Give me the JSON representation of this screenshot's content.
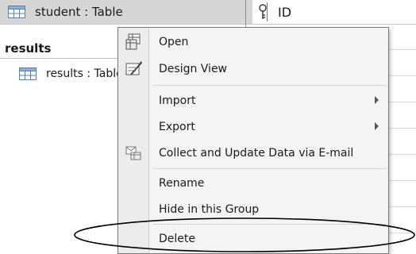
{
  "nav": {
    "selected_item": "student : Table",
    "group_header": "results",
    "child_item": "results : Table"
  },
  "table_header": {
    "column_label": "ID",
    "key_icon": "primary-key-icon"
  },
  "context_menu": {
    "items": [
      {
        "label": "Open",
        "accel": "O",
        "icon": "open-table-icon"
      },
      {
        "label": "Design View",
        "accel": "D",
        "icon": "design-view-icon"
      },
      {
        "label": "Import",
        "accel": "m",
        "submenu": true
      },
      {
        "label": "Export",
        "accel": "E",
        "submenu": true
      },
      {
        "label": "Collect and Update Data via E-mail",
        "accel": "l",
        "icon": "collect-data-icon"
      },
      {
        "label": "Rename",
        "accel": "m"
      },
      {
        "label": "Hide in this Group",
        "accel": "H"
      },
      {
        "label": "Delete",
        "accel": "l"
      }
    ],
    "highlighted_item": "Delete"
  },
  "colors": {
    "menu_bg": "#f4f4f4",
    "selection_bg": "#d6d6d6",
    "annotation": "#000000"
  }
}
